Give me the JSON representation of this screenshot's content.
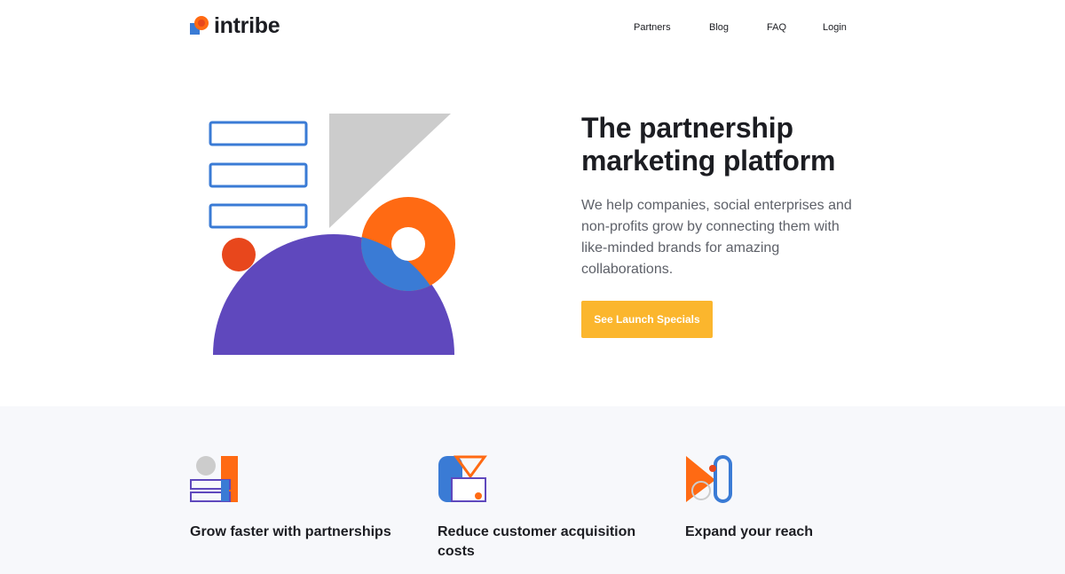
{
  "brand": {
    "name": "intribe",
    "colors": {
      "blue": "#3a7bd5",
      "orange": "#ff6a13",
      "red_orange": "#e8471c",
      "purple": "#5f48bd",
      "gray": "#cfcfcf",
      "cta": "#fbb62d"
    }
  },
  "nav": {
    "items": [
      "Partners",
      "Blog",
      "FAQ",
      "Login"
    ]
  },
  "hero": {
    "title": "The partnership marketing platform",
    "description": "We help companies, social enterprises and non-profits grow by connecting them with like-minded brands for amazing collaborations.",
    "cta_label": "See Launch Specials"
  },
  "features": [
    {
      "icon": "grow-partnerships-icon",
      "title": "Grow faster with partnerships"
    },
    {
      "icon": "reduce-costs-icon",
      "title": "Reduce customer acquisition costs"
    },
    {
      "icon": "expand-reach-icon",
      "title": "Expand your reach"
    }
  ]
}
